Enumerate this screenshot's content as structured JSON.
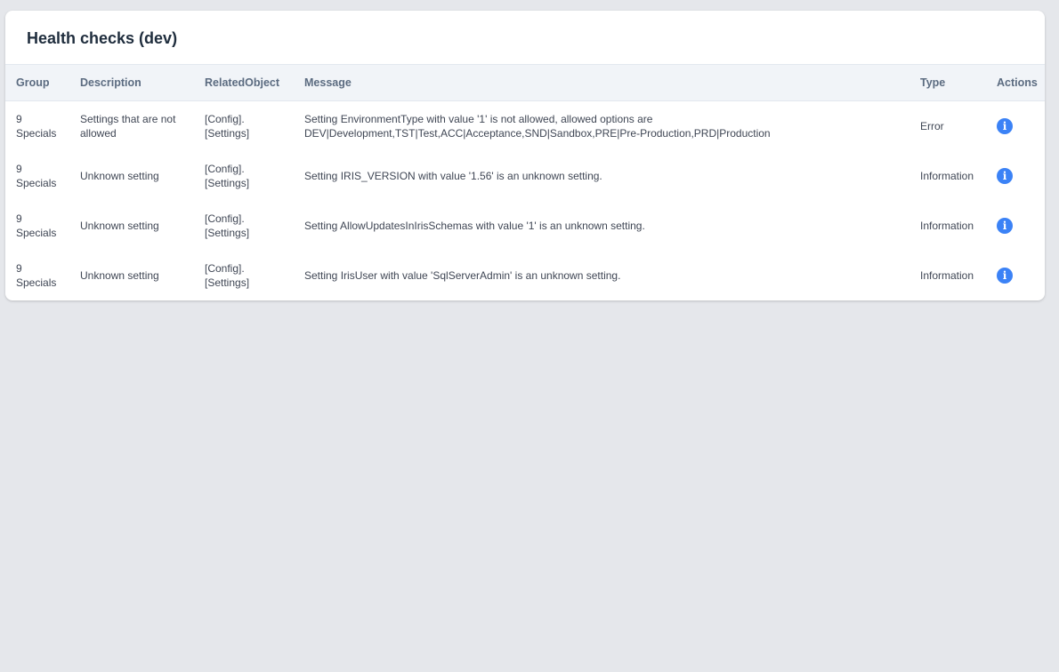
{
  "page": {
    "title": "Health checks (dev)"
  },
  "table": {
    "headers": {
      "group": "Group",
      "description": "Description",
      "related_object": "RelatedObject",
      "message": "Message",
      "type": "Type",
      "actions": "Actions"
    },
    "rows": [
      {
        "group_num": "9",
        "group_name": "Specials",
        "description": "Settings that are not allowed",
        "related_line1": "[Config].",
        "related_line2": "[Settings]",
        "message_line1": "Setting EnvironmentType with value '1' is not allowed, allowed options are",
        "message_line2": "DEV|Development,TST|Test,ACC|Acceptance,SND|Sandbox,PRE|Pre-Production,PRD|Production",
        "type": "Error",
        "action_icon": "info-icon"
      },
      {
        "group_num": "9",
        "group_name": "Specials",
        "description": "Unknown setting",
        "related_line1": "[Config].",
        "related_line2": "[Settings]",
        "message_line1": "Setting IRIS_VERSION with value '1.56' is an unknown setting.",
        "message_line2": "",
        "type": "Information",
        "action_icon": "info-icon"
      },
      {
        "group_num": "9",
        "group_name": "Specials",
        "description": "Unknown setting",
        "related_line1": "[Config].",
        "related_line2": "[Settings]",
        "message_line1": "Setting AllowUpdatesInIrisSchemas with value '1' is an unknown setting.",
        "message_line2": "",
        "type": "Information",
        "action_icon": "info-icon"
      },
      {
        "group_num": "9",
        "group_name": "Specials",
        "description": "Unknown setting",
        "related_line1": "[Config].",
        "related_line2": "[Settings]",
        "message_line1": "Setting IrisUser with value 'SqlServerAdmin' is an unknown setting.",
        "message_line2": "",
        "type": "Information",
        "action_icon": "info-icon"
      }
    ]
  },
  "colors": {
    "background": "#e5e7eb",
    "card": "#ffffff",
    "header_bg": "#f1f4f8",
    "accent": "#3b82f6"
  }
}
